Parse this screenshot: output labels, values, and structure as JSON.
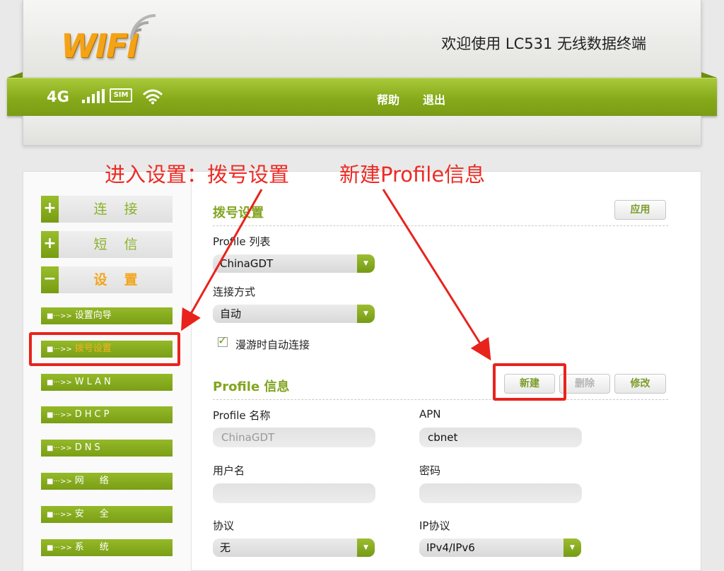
{
  "header": {
    "logo_text": "WIFI",
    "welcome": "欢迎使用 LC531 无线数据终端"
  },
  "status_bar": {
    "network": "4G",
    "sim_label": "SIM",
    "links": [
      "帮助",
      "退出"
    ]
  },
  "annotations": {
    "left": "进入设置：拨号设置",
    "right": "新建Profile信息",
    "color": "#e8231c"
  },
  "sidebar": {
    "menus": [
      {
        "sign": "+",
        "label": "连接"
      },
      {
        "sign": "+",
        "label": "短信"
      },
      {
        "sign": "−",
        "label": "设置",
        "active": true
      }
    ],
    "marker": "■···>>",
    "items": [
      {
        "label": "设置向导"
      },
      {
        "label": "拨号设置",
        "active": true
      },
      {
        "label": "WLAN"
      },
      {
        "label": "DHCP"
      },
      {
        "label": "DNS"
      },
      {
        "label": "网络"
      },
      {
        "label": "安全"
      },
      {
        "label": "系统"
      }
    ]
  },
  "dial": {
    "title": "拨号设置",
    "apply_button": "应用",
    "profile_list_label": "Profile 列表",
    "profile_list_value": "ChinaGDT",
    "connect_mode_label": "连接方式",
    "connect_mode_value": "自动",
    "roaming_label": "漫游时自动连接",
    "roaming_checked": true
  },
  "profile": {
    "title": "Profile 信息",
    "buttons": {
      "new": "新建",
      "delete": "删除",
      "edit": "修改"
    },
    "name_label": "Profile 名称",
    "name_value": "ChinaGDT",
    "apn_label": "APN",
    "apn_value": "cbnet",
    "username_label": "用户名",
    "username_value": "",
    "password_label": "密码",
    "password_value": "",
    "protocol_label": "协议",
    "protocol_value": "无",
    "ip_protocol_label": "IP协议",
    "ip_protocol_value": "IPv4/IPv6"
  },
  "colors": {
    "brand_green": "#86aa1a",
    "accent_orange": "#f2a51b",
    "annotation_red": "#e8231c"
  }
}
